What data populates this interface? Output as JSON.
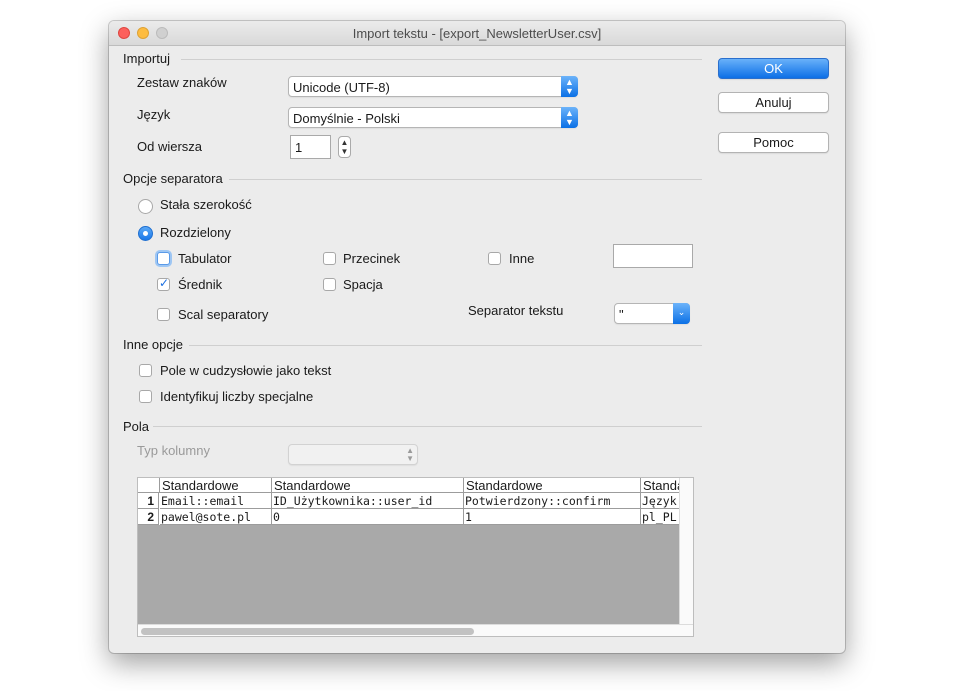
{
  "window": {
    "title": "Import tekstu - [export_NewsletterUser.csv]"
  },
  "import": {
    "section_label": "Importuj",
    "charset_label": "Zestaw znaków",
    "charset_value": "Unicode (UTF-8)",
    "language_label": "Język",
    "language_value": "Domyślnie - Polski",
    "from_row_label": "Od wiersza",
    "from_row_value": "1"
  },
  "separator": {
    "section_label": "Opcje separatora",
    "fixed_width_label": "Stała szerokość",
    "separated_label": "Rozdzielony",
    "tab_label": "Tabulator",
    "comma_label": "Przecinek",
    "other_label": "Inne",
    "other_value": "",
    "semicolon_label": "Średnik",
    "space_label": "Spacja",
    "merge_label": "Scal separatory",
    "text_separator_label": "Separator tekstu",
    "text_separator_value": "\"",
    "states": {
      "fixed_width": false,
      "separated": true,
      "tab": false,
      "comma": false,
      "other": false,
      "semicolon": true,
      "space": false,
      "merge": false
    }
  },
  "other_options": {
    "section_label": "Inne opcje",
    "quoted_as_text_label": "Pole w cudzysłowie jako tekst",
    "detect_special_label": "Identyfikuj liczby specjalne",
    "states": {
      "quoted_as_text": false,
      "detect_special": false
    }
  },
  "fields": {
    "section_label": "Pola",
    "column_type_label": "Typ kolumny",
    "column_type_value": "",
    "headers": [
      "Standardowe",
      "Standardowe",
      "Standardowe",
      "Standardowe"
    ],
    "rows": [
      {
        "num": "1",
        "cells": [
          "Email::email",
          "ID_Użytkownika::user_id",
          "Potwierdzony::confirm",
          "Język"
        ]
      },
      {
        "num": "2",
        "cells": [
          "pawel@sote.pl",
          "0",
          "1",
          "pl_PL"
        ]
      }
    ]
  },
  "buttons": {
    "ok": "OK",
    "cancel": "Anuluj",
    "help": "Pomoc"
  },
  "colors": {
    "accent": "#0d6fe6",
    "window_bg": "#ececec",
    "preview_empty": "#a9a9a9"
  }
}
